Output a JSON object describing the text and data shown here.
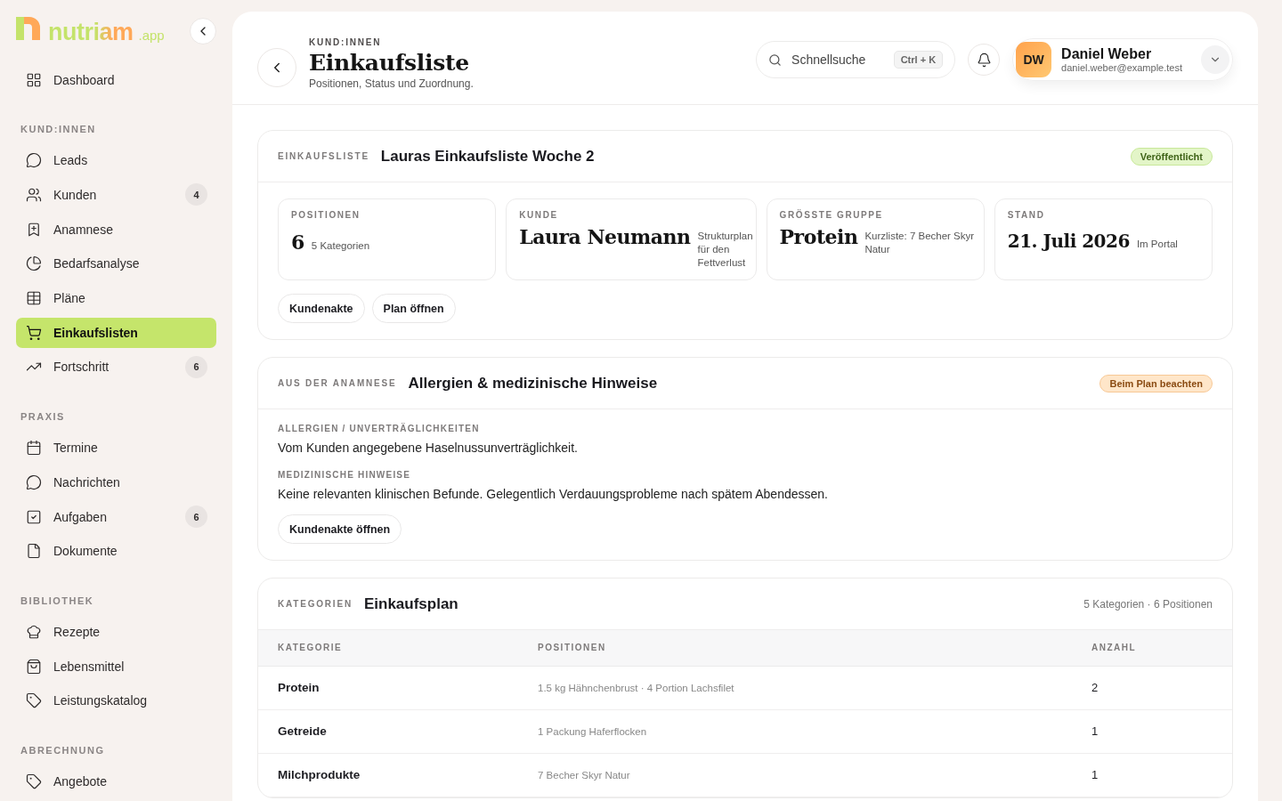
{
  "logo": {
    "name": "nutriam",
    "suffix": ".app"
  },
  "sidebar": {
    "items": [
      {
        "label": "Dashboard",
        "selected": false
      }
    ],
    "sections": [
      {
        "title": "KUND:INNEN",
        "items": [
          {
            "label": "Leads",
            "selected": false
          },
          {
            "label": "Kunden",
            "badge": "4",
            "selected": false
          },
          {
            "label": "Anamnese",
            "selected": false
          },
          {
            "label": "Bedarfsanalyse",
            "selected": false
          },
          {
            "label": "Pläne",
            "selected": false
          },
          {
            "label": "Einkaufslisten",
            "selected": true
          },
          {
            "label": "Fortschritt",
            "badge": "6",
            "selected": false
          }
        ]
      },
      {
        "title": "PRAXIS",
        "items": [
          {
            "label": "Termine",
            "selected": false
          },
          {
            "label": "Nachrichten",
            "selected": false
          },
          {
            "label": "Aufgaben",
            "badge": "6",
            "selected": false
          },
          {
            "label": "Dokumente",
            "selected": false
          }
        ]
      },
      {
        "title": "BIBLIOTHEK",
        "items": [
          {
            "label": "Rezepte",
            "selected": false
          },
          {
            "label": "Lebensmittel",
            "selected": false
          },
          {
            "label": "Leistungskatalog",
            "selected": false
          }
        ]
      },
      {
        "title": "ABRECHNUNG",
        "items": [
          {
            "label": "Angebote",
            "selected": false
          }
        ]
      }
    ]
  },
  "header": {
    "eyebrow": "KUND:INNEN",
    "title": "Einkaufsliste",
    "subtitle": "Positionen, Status und Zuordnung.",
    "search": {
      "placeholder": "Schnellsuche",
      "shortcut": "Ctrl + K"
    },
    "user": {
      "initials": "DW",
      "name": "Daniel Weber",
      "email": "daniel.weber@example.test"
    }
  },
  "list_card": {
    "eyebrow": "EINKAUFSLISTE",
    "title": "Lauras Einkaufsliste Woche 2",
    "badge": {
      "label": "Veröffentlicht",
      "kind": "success"
    },
    "stats": [
      {
        "label": "POSITIONEN",
        "value": "6",
        "note": "5 Kategorien"
      },
      {
        "label": "KUNDE",
        "value": "Laura Neumann",
        "note": "Strukturplan für den Fettverlust"
      },
      {
        "label": "GRÖSSTE GRUPPE",
        "value": "Protein",
        "note": "Kurzliste: 7 Becher Skyr Natur"
      },
      {
        "label": "STAND",
        "value": "21. Juli 2026",
        "note": "Im Portal"
      }
    ],
    "buttons": [
      "Kundenakte",
      "Plan öffnen"
    ]
  },
  "anamnesis_card": {
    "eyebrow": "AUS DER ANAMNESE",
    "title": "Allergien & medizinische Hinweise",
    "badge": {
      "label": "Beim Plan beachten",
      "kind": "warning"
    },
    "fields": [
      {
        "label": "ALLERGIEN / UNVERTRÄGLICHKEITEN",
        "text": "Vom Kunden angegebene Haselnussunverträglichkeit."
      },
      {
        "label": "MEDIZINISCHE HINWEISE",
        "text": "Keine relevanten klinischen Befunde. Gelegentlich Verdauungsprobleme nach spätem Abendessen."
      }
    ],
    "buttons": [
      "Kundenakte öffnen"
    ]
  },
  "plan_card": {
    "eyebrow": "KATEGORIEN",
    "title": "Einkaufsplan",
    "meta": "5 Kategorien · 6 Positionen",
    "table": {
      "columns": [
        "KATEGORIE",
        "POSITIONEN",
        "ANZAHL"
      ],
      "rows": [
        {
          "category": "Protein",
          "items": "1.5 kg Hähnchenbrust · 4 Portion Lachsfilet",
          "count": "2"
        },
        {
          "category": "Getreide",
          "items": "1 Packung Haferflocken",
          "count": "1"
        },
        {
          "category": "Milchprodukte",
          "items": "7 Becher Skyr Natur",
          "count": "1"
        }
      ]
    }
  }
}
